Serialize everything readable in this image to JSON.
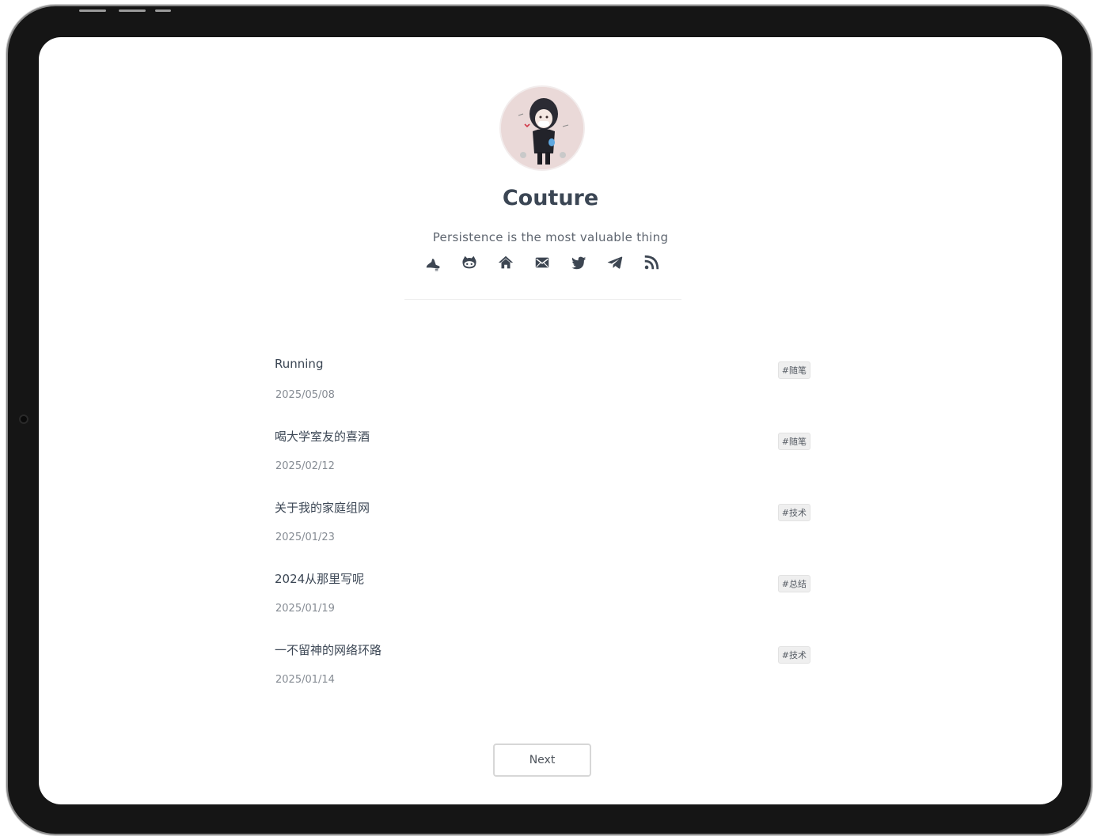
{
  "profile": {
    "name": "Couture",
    "bio": "Persistence is the most valuable thing",
    "avatar_icon": "avatar-illustration"
  },
  "social_links": [
    {
      "icon": "running-shoe-icon",
      "label": "running"
    },
    {
      "icon": "github-icon",
      "label": "github"
    },
    {
      "icon": "home-icon",
      "label": "home"
    },
    {
      "icon": "mail-icon",
      "label": "email"
    },
    {
      "icon": "twitter-icon",
      "label": "twitter"
    },
    {
      "icon": "telegram-icon",
      "label": "telegram"
    },
    {
      "icon": "rss-icon",
      "label": "rss"
    }
  ],
  "posts": [
    {
      "title": "Running",
      "date": "2025/05/08",
      "tag": "#随笔"
    },
    {
      "title": "喝大学室友的喜酒",
      "date": "2025/02/12",
      "tag": "#随笔"
    },
    {
      "title": "关于我的家庭组网",
      "date": "2025/01/23",
      "tag": "#技术"
    },
    {
      "title": "2024从那里写呢",
      "date": "2025/01/19",
      "tag": "#总结"
    },
    {
      "title": "一不留神的网络环路",
      "date": "2025/01/14",
      "tag": "#技术"
    }
  ],
  "pagination": {
    "next_label": "Next"
  },
  "colors": {
    "text": "#3b4654",
    "muted": "#868c94",
    "icon": "#3d4652",
    "bezel": "#151515"
  }
}
